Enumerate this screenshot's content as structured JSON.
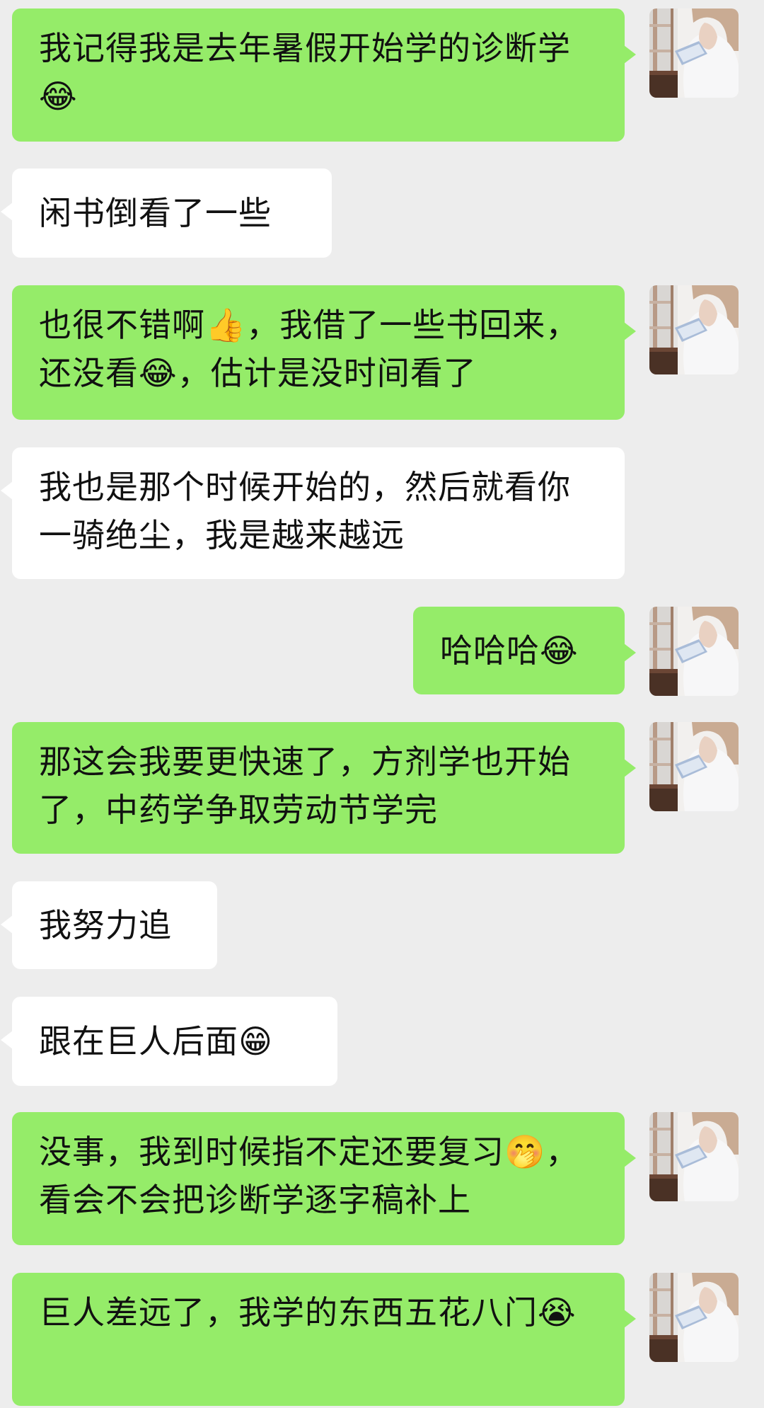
{
  "chat": {
    "messages": [
      {
        "side": "right",
        "text": "我记得我是去年暑假开始学的诊断学😂",
        "avatar": "self-avatar"
      },
      {
        "side": "left",
        "text": "闲书倒看了一些"
      },
      {
        "side": "right",
        "text": "也很不错啊👍，我借了一些书回来，还没看😂，估计是没时间看了",
        "avatar": "self-avatar"
      },
      {
        "side": "left",
        "text": "我也是那个时候开始的，然后就看你一骑绝尘，我是越来越远"
      },
      {
        "side": "right",
        "text": "哈哈哈😂",
        "avatar": "self-avatar"
      },
      {
        "side": "right",
        "text": "那这会我要更快速了，方剂学也开始了，中药学争取劳动节学完",
        "avatar": "self-avatar"
      },
      {
        "side": "left",
        "text": "我努力追"
      },
      {
        "side": "left",
        "text": "跟在巨人后面😁"
      },
      {
        "side": "right",
        "text": "没事，我到时候指不定还要复习🤭，看会不会把诊断学逐字稿补上",
        "avatar": "self-avatar"
      },
      {
        "side": "right",
        "text": "巨人差远了，我学的东西五花八门😭",
        "avatar": "self-avatar"
      }
    ]
  },
  "colors": {
    "background": "#ededed",
    "sent_bubble": "#95ec69",
    "received_bubble": "#ffffff",
    "text": "#111111"
  }
}
